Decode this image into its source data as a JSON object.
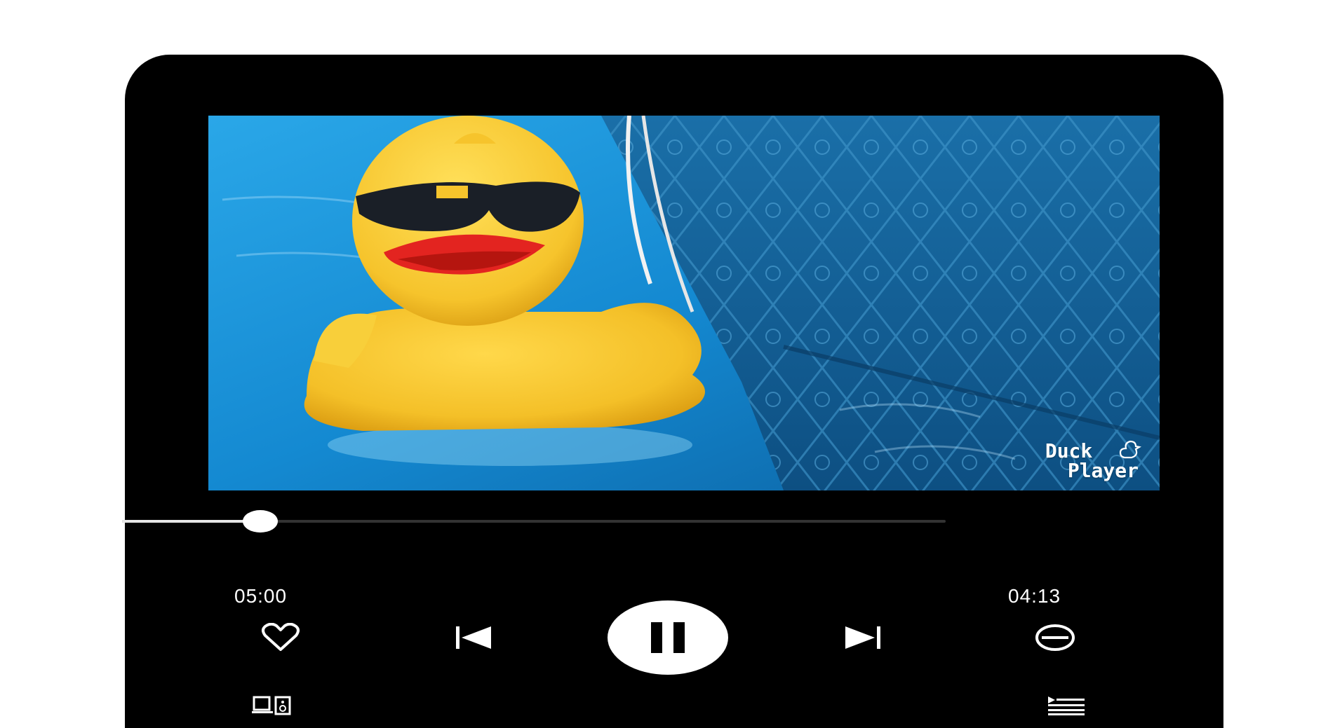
{
  "player": {
    "watermark": {
      "line1": "Duck",
      "line2": "Player"
    },
    "progress": {
      "fraction": 0.168
    },
    "time_elapsed": "05:00",
    "time_remaining": "04:13",
    "controls": {
      "like_icon": "heart-icon",
      "previous_icon": "skip-previous-icon",
      "play_pause_icon": "pause-icon",
      "next_icon": "skip-next-icon",
      "remove_icon": "minus-circle-icon",
      "devices_icon": "devices-icon",
      "queue_icon": "queue-icon"
    }
  },
  "colors": {
    "background": "#000000",
    "accent": "#ffffff",
    "track": "#333333"
  }
}
